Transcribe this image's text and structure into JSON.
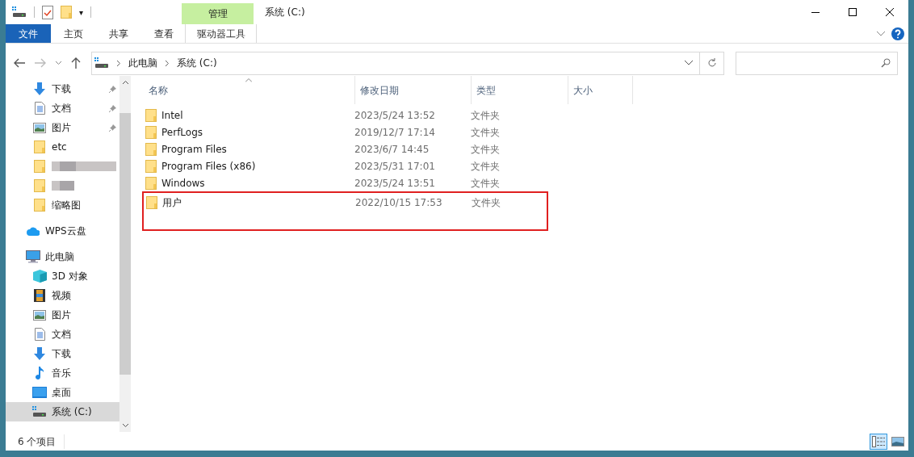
{
  "quick_access_toolbar": {
    "dropdown": "▾"
  },
  "context_tab": {
    "group": "管理",
    "label": "驱动器工具"
  },
  "window": {
    "title": "系统 (C:)"
  },
  "ribbon_tabs": [
    {
      "label": "文件",
      "kind": "file"
    },
    {
      "label": "主页",
      "kind": "tab"
    },
    {
      "label": "共享",
      "kind": "tab"
    },
    {
      "label": "查看",
      "kind": "tab"
    }
  ],
  "address_bar": {
    "path": [
      "此电脑",
      "系统 (C:)"
    ]
  },
  "sidebar": {
    "items": [
      {
        "label": "下载",
        "kind": "download",
        "pinned": true,
        "selected": false
      },
      {
        "label": "文档",
        "kind": "document",
        "pinned": true,
        "selected": false
      },
      {
        "label": "图片",
        "kind": "pictures",
        "pinned": true,
        "selected": false
      },
      {
        "label": "etc",
        "kind": "folder",
        "pinned": false,
        "selected": false
      },
      {
        "kind": "blurred",
        "pinned": false,
        "selected": false
      },
      {
        "kind": "blurred-short",
        "pinned": false,
        "selected": false
      },
      {
        "label": "缩略图",
        "kind": "folder",
        "pinned": false,
        "selected": false
      },
      {
        "label": "WPS云盘",
        "kind": "cloud",
        "pinned": false,
        "selected": false
      },
      {
        "label": "此电脑",
        "kind": "pc",
        "pinned": false,
        "selected": false
      },
      {
        "label": "3D 对象",
        "kind": "cube",
        "pinned": false,
        "selected": false
      },
      {
        "label": "视频",
        "kind": "video",
        "pinned": false,
        "selected": false
      },
      {
        "label": "图片",
        "kind": "pictures",
        "pinned": false,
        "selected": false
      },
      {
        "label": "文档",
        "kind": "document",
        "pinned": false,
        "selected": false
      },
      {
        "label": "下载",
        "kind": "download",
        "pinned": false,
        "selected": false
      },
      {
        "label": "音乐",
        "kind": "music",
        "pinned": false,
        "selected": false
      },
      {
        "label": "桌面",
        "kind": "desktop",
        "pinned": false,
        "selected": false
      },
      {
        "label": "系统 (C:)",
        "kind": "drive",
        "pinned": false,
        "selected": true
      }
    ]
  },
  "table": {
    "columns": [
      "名称",
      "修改日期",
      "类型",
      "大小"
    ],
    "rows": [
      {
        "name": "Intel",
        "date": "2023/5/24 13:52",
        "type": "文件夹",
        "highlighted": false
      },
      {
        "name": "PerfLogs",
        "date": "2019/12/7 17:14",
        "type": "文件夹",
        "highlighted": false
      },
      {
        "name": "Program Files",
        "date": "2023/6/7 14:45",
        "type": "文件夹",
        "highlighted": false
      },
      {
        "name": "Program Files (x86)",
        "date": "2023/5/31 17:01",
        "type": "文件夹",
        "highlighted": false
      },
      {
        "name": "Windows",
        "date": "2023/5/24 13:51",
        "type": "文件夹",
        "highlighted": false
      },
      {
        "name": "用户",
        "date": "2022/10/15 17:53",
        "type": "文件夹",
        "highlighted": true
      }
    ]
  },
  "status_bar": {
    "count": "6 个项目",
    "views": [
      {
        "kind": "details",
        "selected": true
      },
      {
        "kind": "large",
        "selected": false
      }
    ]
  }
}
